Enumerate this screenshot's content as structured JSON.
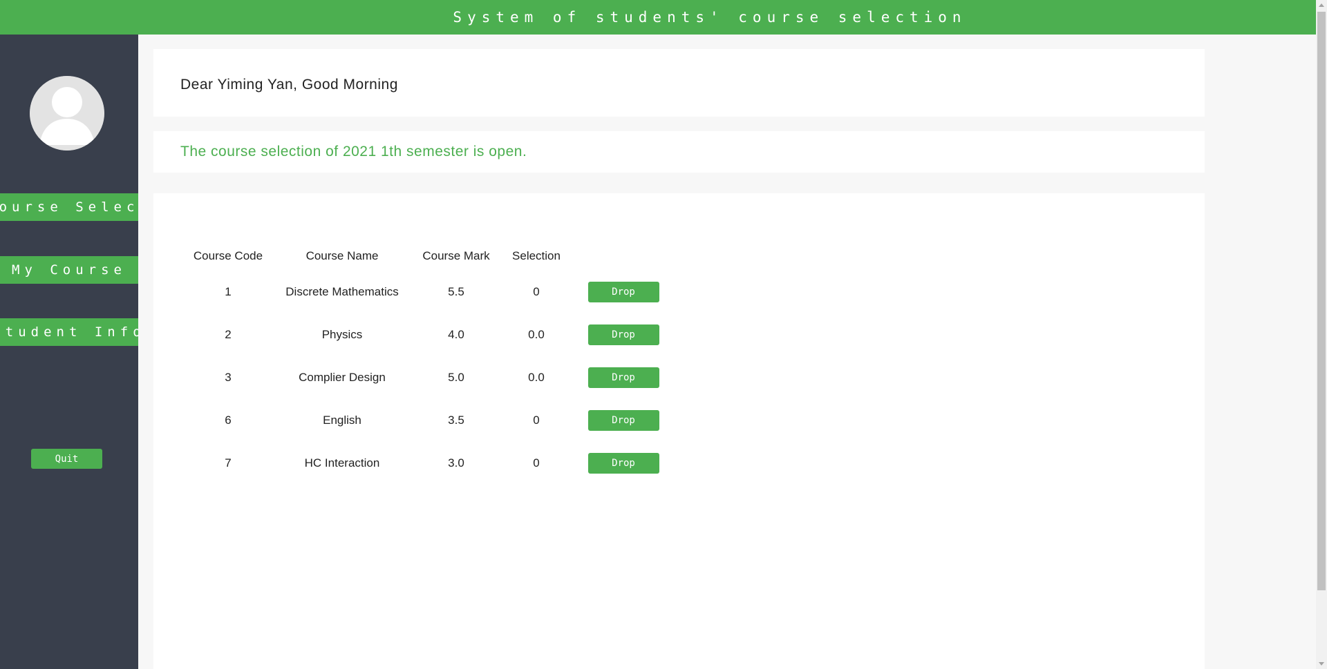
{
  "header": {
    "title": "System of students' course selection"
  },
  "sidebar": {
    "avatar_icon": "user-avatar-icon",
    "items": [
      {
        "label": "Course Select"
      },
      {
        "label": "My Course"
      },
      {
        "label": "Student Info"
      }
    ],
    "quit_label": "Quit"
  },
  "main": {
    "greeting": "Dear Yiming Yan, Good Morning",
    "notice": "The course selection of 2021 1th semester is open.",
    "table": {
      "headers": [
        "Course Code",
        "Course Name",
        "Course Mark",
        "Selection"
      ],
      "rows": [
        {
          "code": "1",
          "name": "Discrete Mathematics",
          "mark": "5.5",
          "selection": "0",
          "action": "Drop"
        },
        {
          "code": "2",
          "name": "Physics",
          "mark": "4.0",
          "selection": "0.0",
          "action": "Drop"
        },
        {
          "code": "3",
          "name": "Complier Design",
          "mark": "5.0",
          "selection": "0.0",
          "action": "Drop"
        },
        {
          "code": "6",
          "name": "English",
          "mark": "3.5",
          "selection": "0",
          "action": "Drop"
        },
        {
          "code": "7",
          "name": "HC Interaction",
          "mark": "3.0",
          "selection": "0",
          "action": "Drop"
        }
      ]
    }
  },
  "colors": {
    "accent": "#4caf50",
    "sidebar_bg": "#393f4c",
    "page_bg": "#f7f7f7"
  }
}
